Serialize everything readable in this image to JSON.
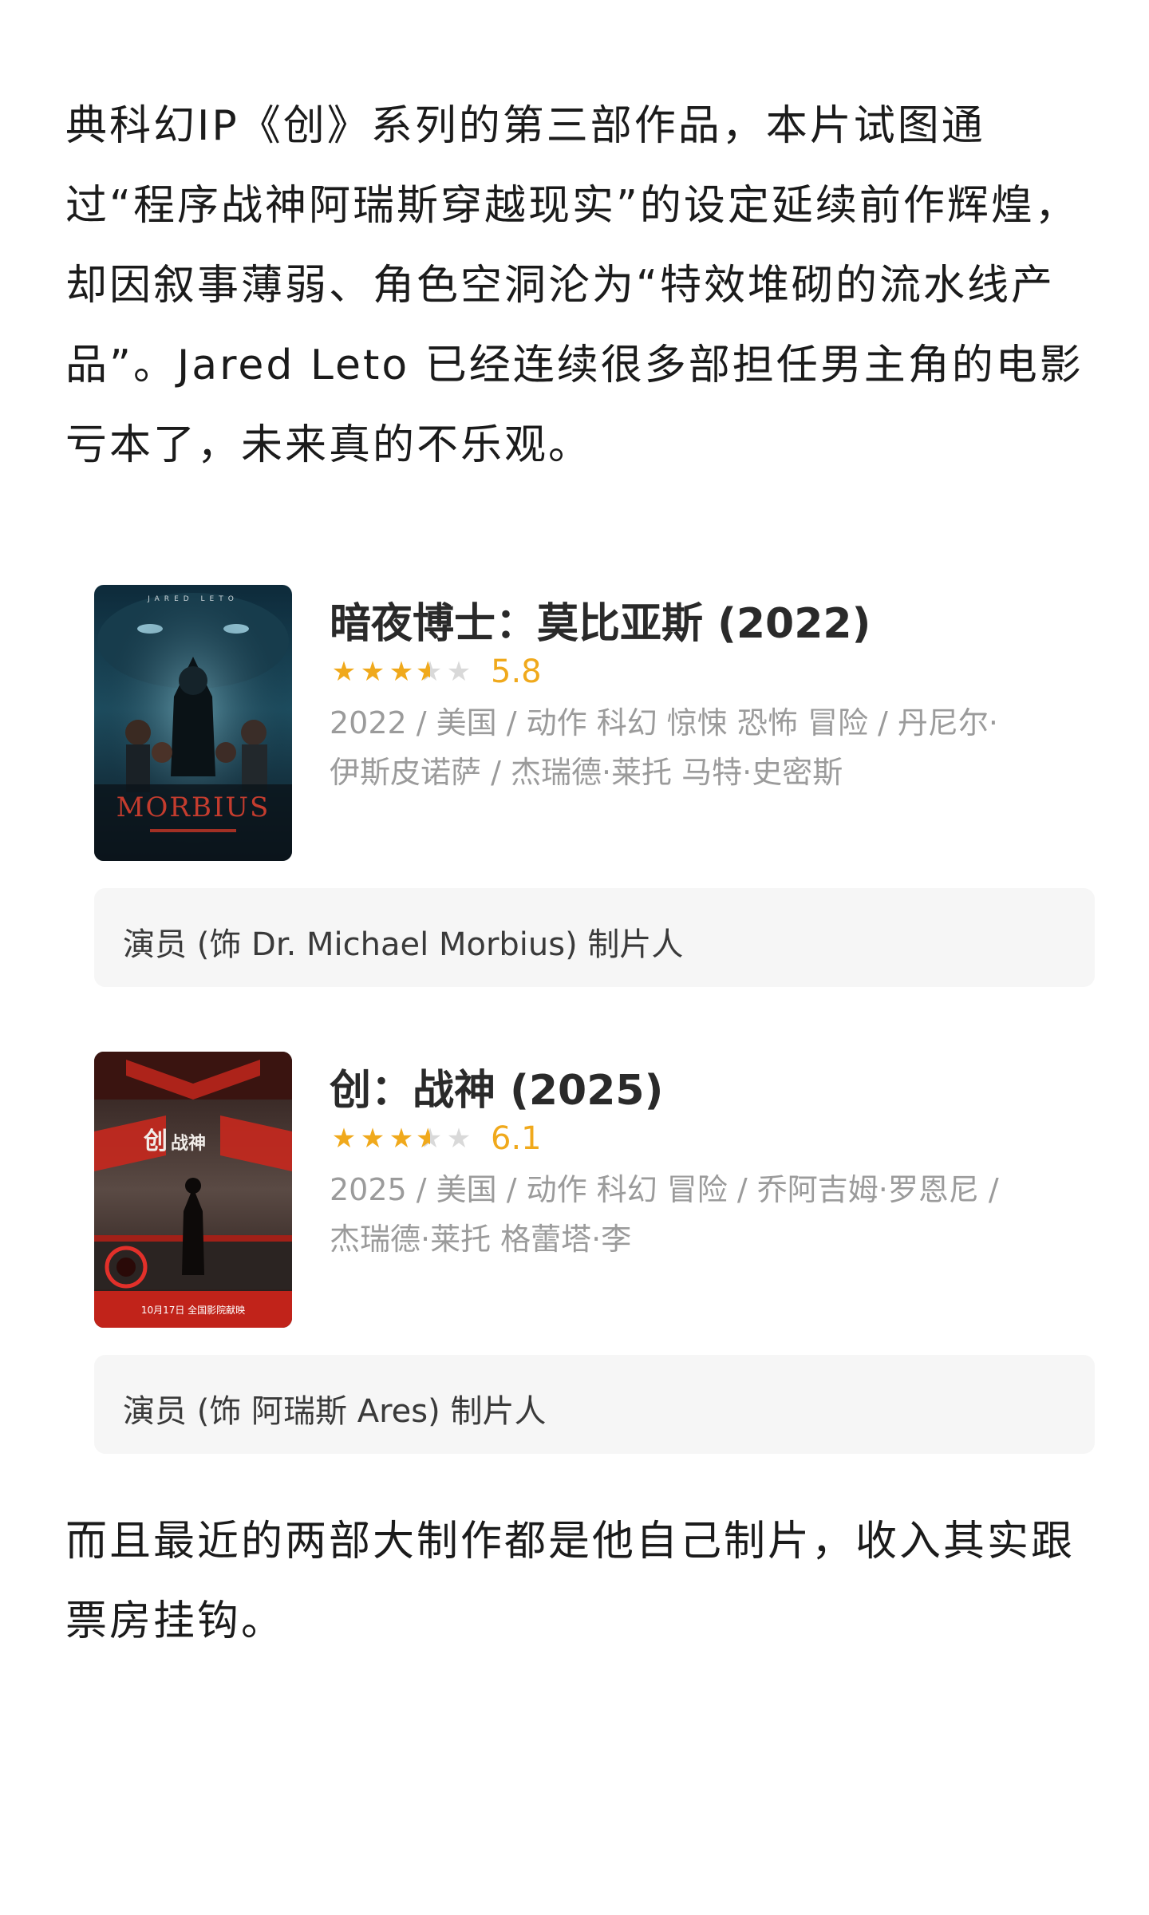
{
  "paragraphs": {
    "top": "典科幻IP《创》系列的第三部作品，本片试图通过“程序战神阿瑞斯穿越现实”的设定延续前作辉煌，却因叙事薄弱、角色空洞沦为“特效堆砌的流水线产品”。Jared Leto 已经连续很多部担任男主角的电影亏本了，未来真的不乐观。",
    "bottom": "而且最近的两部大制作都是他自己制片，收入其实跟票房挂钩。"
  },
  "movies": [
    {
      "title": "暗夜博士：莫比亚斯 (2022)",
      "rating": "5.8",
      "stars": [
        "full",
        "full",
        "full",
        "half",
        "empty"
      ],
      "meta": "2022 / 美国 / 动作 科幻 惊悚 恐怖 冒险 / 丹尼尔·伊斯皮诺萨 / 杰瑞德·莱托 马特·史密斯",
      "role": "演员 (饰 Dr. Michael Morbius) 制片人",
      "poster_icon": "morbius-poster",
      "poster_text": "MORBIUS"
    },
    {
      "title": "创：战神 (2025)",
      "rating": "6.1",
      "stars": [
        "full",
        "full",
        "full",
        "half",
        "empty"
      ],
      "meta": "2025 / 美国 / 动作 科幻 冒险 / 乔阿吉姆·罗恩尼 / 杰瑞德·莱托 格蕾塔·李",
      "role": "演员 (饰 阿瑞斯 Ares) 制片人",
      "poster_icon": "tron-ares-poster",
      "poster_text": "创战神"
    }
  ],
  "colors": {
    "star": "#f0a91c",
    "meta": "#9b9b9b",
    "role_bg": "#f6f6f6"
  }
}
